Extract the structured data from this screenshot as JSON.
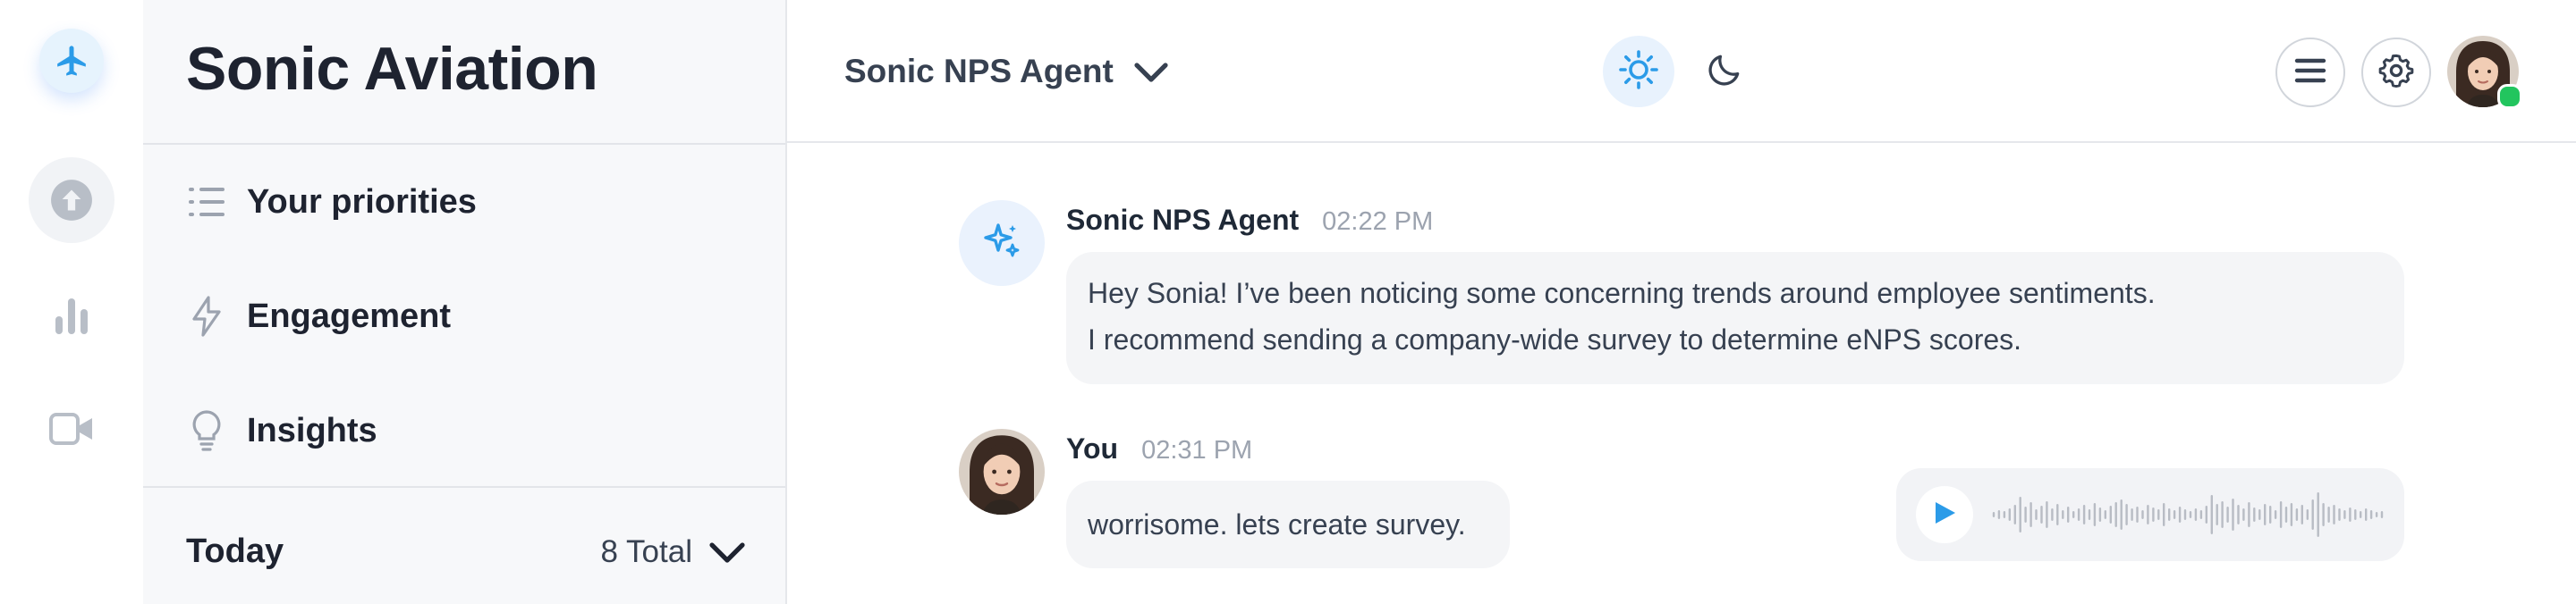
{
  "brand": {
    "title": "Sonic Aviation"
  },
  "rail": {
    "icons": [
      "airplane-icon",
      "upload-icon",
      "bar-chart-icon",
      "video-icon"
    ]
  },
  "nav": {
    "items": [
      {
        "label": "Your priorities",
        "icon": "list-icon"
      },
      {
        "label": "Engagement",
        "icon": "lightning-icon"
      },
      {
        "label": "Insights",
        "icon": "lightbulb-icon"
      }
    ],
    "today": {
      "label": "Today",
      "total": "8 Total"
    }
  },
  "header": {
    "agent_name": "Sonic NPS Agent",
    "theme_options": [
      "light",
      "dark"
    ],
    "active_theme": "light"
  },
  "chat": {
    "messages": [
      {
        "author": "Sonic NPS Agent",
        "time": "02:22 PM",
        "lines": [
          "Hey Sonia! I’ve been noticing some concerning trends around employee sentiments.",
          "I recommend sending a company-wide survey to determine eNPS scores."
        ]
      },
      {
        "author": "You",
        "time": "02:31 PM",
        "lines": [
          "worrisome. lets create survey."
        ]
      }
    ]
  },
  "colors": {
    "accent": "#2b9be8",
    "online": "#22c55e",
    "panel_bg": "#f7f8fa",
    "bubble_bg": "#f4f5f7"
  }
}
